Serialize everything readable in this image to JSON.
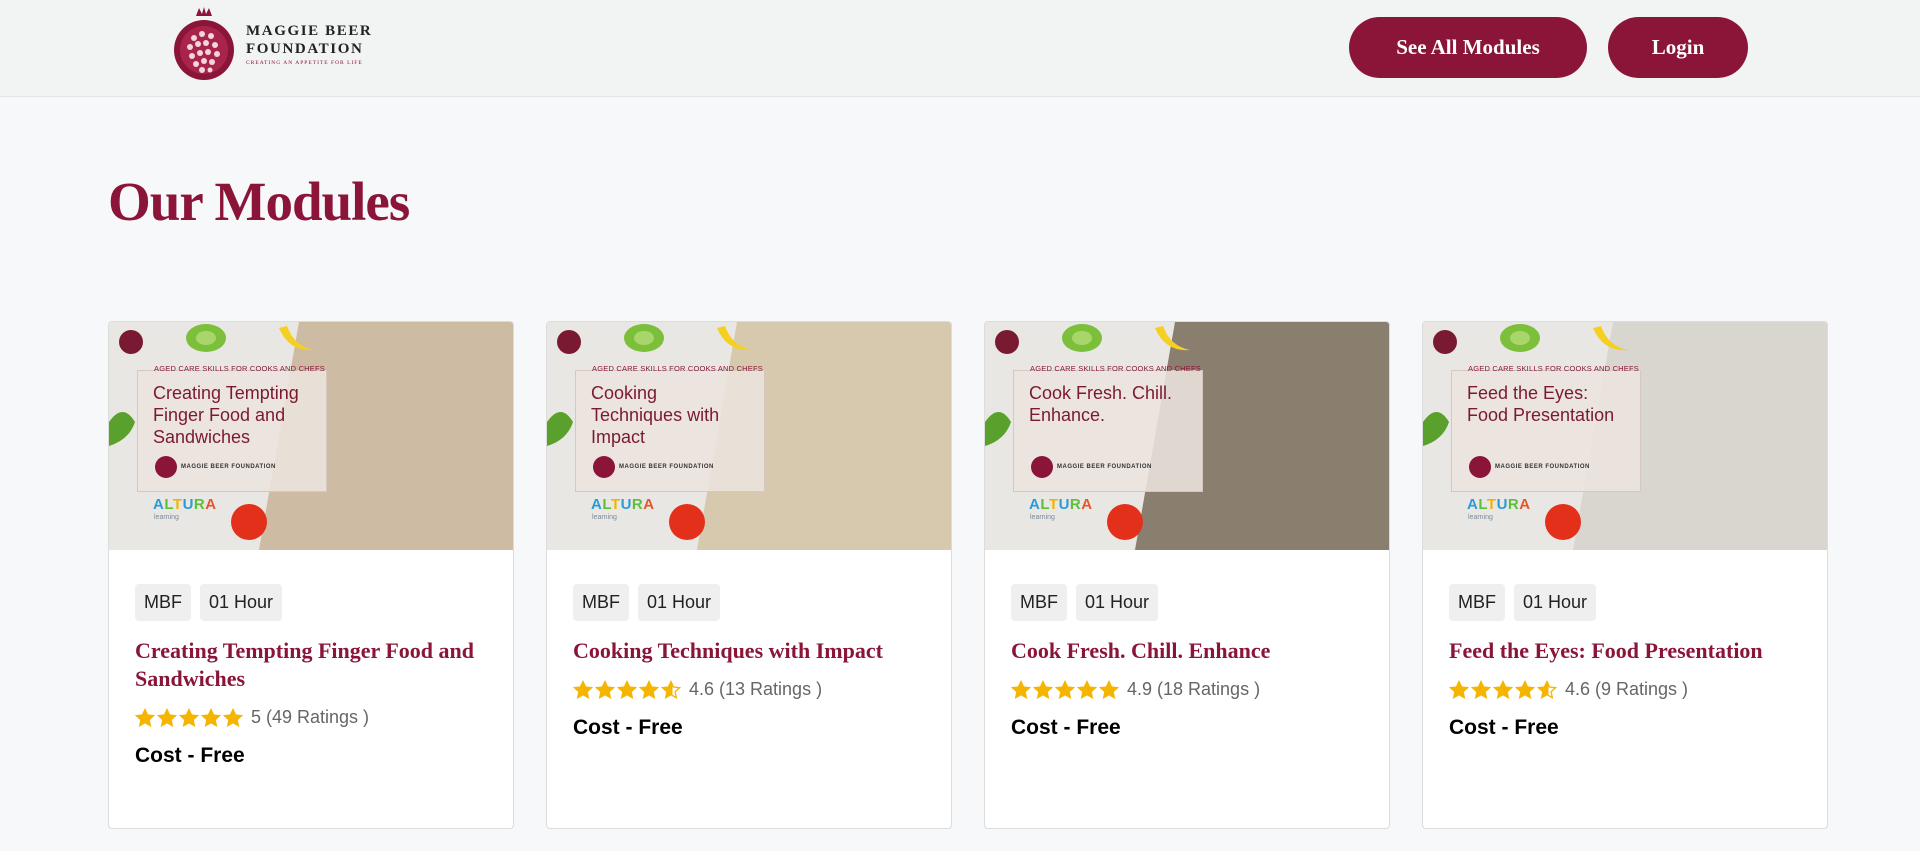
{
  "header": {
    "logo": {
      "line1": "MAGGIE BEER",
      "line2": "FOUNDATION",
      "tagline": "CREATING AN APPETITE FOR LIFE"
    },
    "see_all_label": "See All Modules",
    "login_label": "Login"
  },
  "page_title": "Our Modules",
  "colors": {
    "brand": "#8b1538",
    "star": "#f5b400",
    "header_bg": "#f2f3f3",
    "page_bg": "#f7f8fa"
  },
  "modules": [
    {
      "thumb_tag": "AGED CARE SKILLS FOR COOKS AND CHEFS",
      "thumb_title": "Creating Tempting Finger Food and Sandwiches",
      "thumb_mbf": "MAGGIE BEER FOUNDATION",
      "thumb_altura": "ALTURA",
      "thumb_learning": "learning",
      "badges": [
        "MBF",
        "01 Hour"
      ],
      "title": "Creating Tempting Finger Food and Sandwiches",
      "rating_value": 5,
      "rating_text": "5 (49 Ratings )",
      "cost": "Cost - Free"
    },
    {
      "thumb_tag": "AGED CARE SKILLS FOR COOKS AND CHEFS",
      "thumb_title": "Cooking Techniques with Impact",
      "thumb_mbf": "MAGGIE BEER FOUNDATION",
      "thumb_altura": "ALTURA",
      "thumb_learning": "learning",
      "badges": [
        "MBF",
        "01 Hour"
      ],
      "title": "Cooking Techniques with Impact",
      "rating_value": 4.6,
      "rating_text": "4.6 (13 Ratings )",
      "cost": "Cost - Free"
    },
    {
      "thumb_tag": "AGED CARE SKILLS FOR COOKS AND CHEFS",
      "thumb_title": "Cook Fresh. Chill. Enhance.",
      "thumb_mbf": "MAGGIE BEER FOUNDATION",
      "thumb_altura": "ALTURA",
      "thumb_learning": "learning",
      "badges": [
        "MBF",
        "01 Hour"
      ],
      "title": "Cook Fresh. Chill. Enhance",
      "rating_value": 4.9,
      "rating_text": "4.9 (18 Ratings )",
      "cost": "Cost - Free"
    },
    {
      "thumb_tag": "AGED CARE SKILLS FOR COOKS AND CHEFS",
      "thumb_title": "Feed the Eyes: Food Presentation",
      "thumb_mbf": "MAGGIE BEER FOUNDATION",
      "thumb_altura": "ALTURA",
      "thumb_learning": "learning",
      "badges": [
        "MBF",
        "01 Hour"
      ],
      "title": "Feed the Eyes: Food Presentation",
      "rating_value": 4.6,
      "rating_text": "4.6 (9 Ratings )",
      "cost": "Cost - Free"
    }
  ]
}
